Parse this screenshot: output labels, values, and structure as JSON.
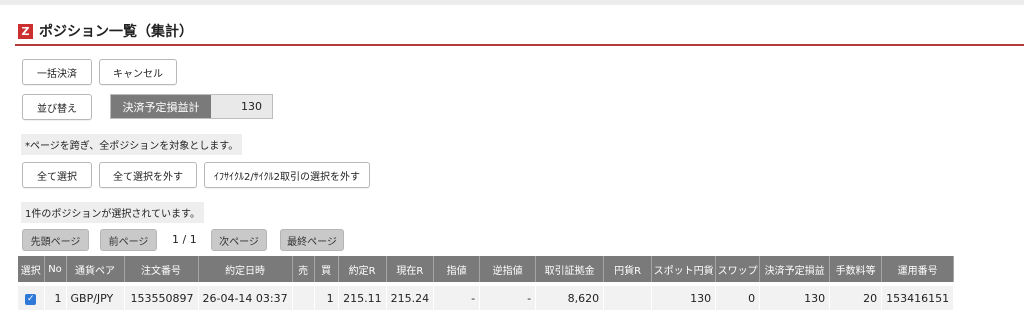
{
  "header": {
    "icon_letter": "Z",
    "title": "ポジション一覧（集計）"
  },
  "buttons": {
    "bulk_settle": "一括決済",
    "cancel": "キャンセル",
    "sort": "並び替え",
    "select_all": "全て選択",
    "deselect_all": "全て選択を外す",
    "cycle_deselect": "ｲﾌｻｲｸﾙ2/ｻｲｸﾙ2取引の選択を外す"
  },
  "pl_summary": {
    "label": "決済予定損益計",
    "value": "130"
  },
  "notes": {
    "cross_page": "*ページを跨ぎ、全ポジションを対象とします。",
    "selected_count": "1件のポジションが選択されています。"
  },
  "pager": {
    "first": "先頭ページ",
    "prev": "前ページ",
    "position": "1 / 1",
    "next": "次ページ",
    "last": "最終ページ"
  },
  "table": {
    "headers": [
      "選択",
      "No",
      "通貨ペア",
      "注文番号",
      "約定日時",
      "売",
      "買",
      "約定R",
      "現在R",
      "指値",
      "逆指値",
      "取引証拠金",
      "円貨R",
      "スポット円貨",
      "スワップ",
      "決済予定損益",
      "手数料等",
      "運用番号"
    ],
    "rows": [
      {
        "checked": "✓",
        "no": "1",
        "pair": "GBP/JPY",
        "order_no": "153550897",
        "exec_datetime": "26-04-14 03:37",
        "sell": "",
        "buy": "1",
        "exec_rate": "215.11",
        "current_rate": "215.24",
        "limit": "-",
        "stop": "-",
        "margin": "8,620",
        "yen_rate": "",
        "spot_yen": "130",
        "swap": "0",
        "planned_pl": "130",
        "fees": "20",
        "operation_no": "153416151"
      }
    ]
  }
}
